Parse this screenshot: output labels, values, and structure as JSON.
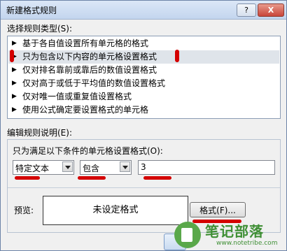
{
  "dialog": {
    "title": "新建格式规则",
    "help_label": "?",
    "close_label": "X"
  },
  "rule_type": {
    "label": "选择规则类型(S):",
    "items": [
      {
        "label": "基于各自值设置所有单元格的格式"
      },
      {
        "label": "只为包含以下内容的单元格设置格式"
      },
      {
        "label": "仅对排名靠前或靠后的数值设置格式"
      },
      {
        "label": "仅对高于或低于平均值的数值设置格式"
      },
      {
        "label": "仅对唯一值或重复值设置格式"
      },
      {
        "label": "使用公式确定要设置格式的单元格"
      }
    ],
    "selected_index": 1
  },
  "description": {
    "label": "编辑规则说明(E):",
    "condition_label": "只为满足以下条件的单元格设置格式(O):",
    "field_type": "特定文本",
    "operator": "包含",
    "value": "3",
    "preview_label": "预览:",
    "preview_text": "未设定格式",
    "format_button": "格式(F)..."
  },
  "watermark": {
    "name": "笔记部落",
    "url": "www.notetribe.com"
  },
  "colors": {
    "annotation": "#d40000",
    "selection": "#dfe4ea"
  }
}
